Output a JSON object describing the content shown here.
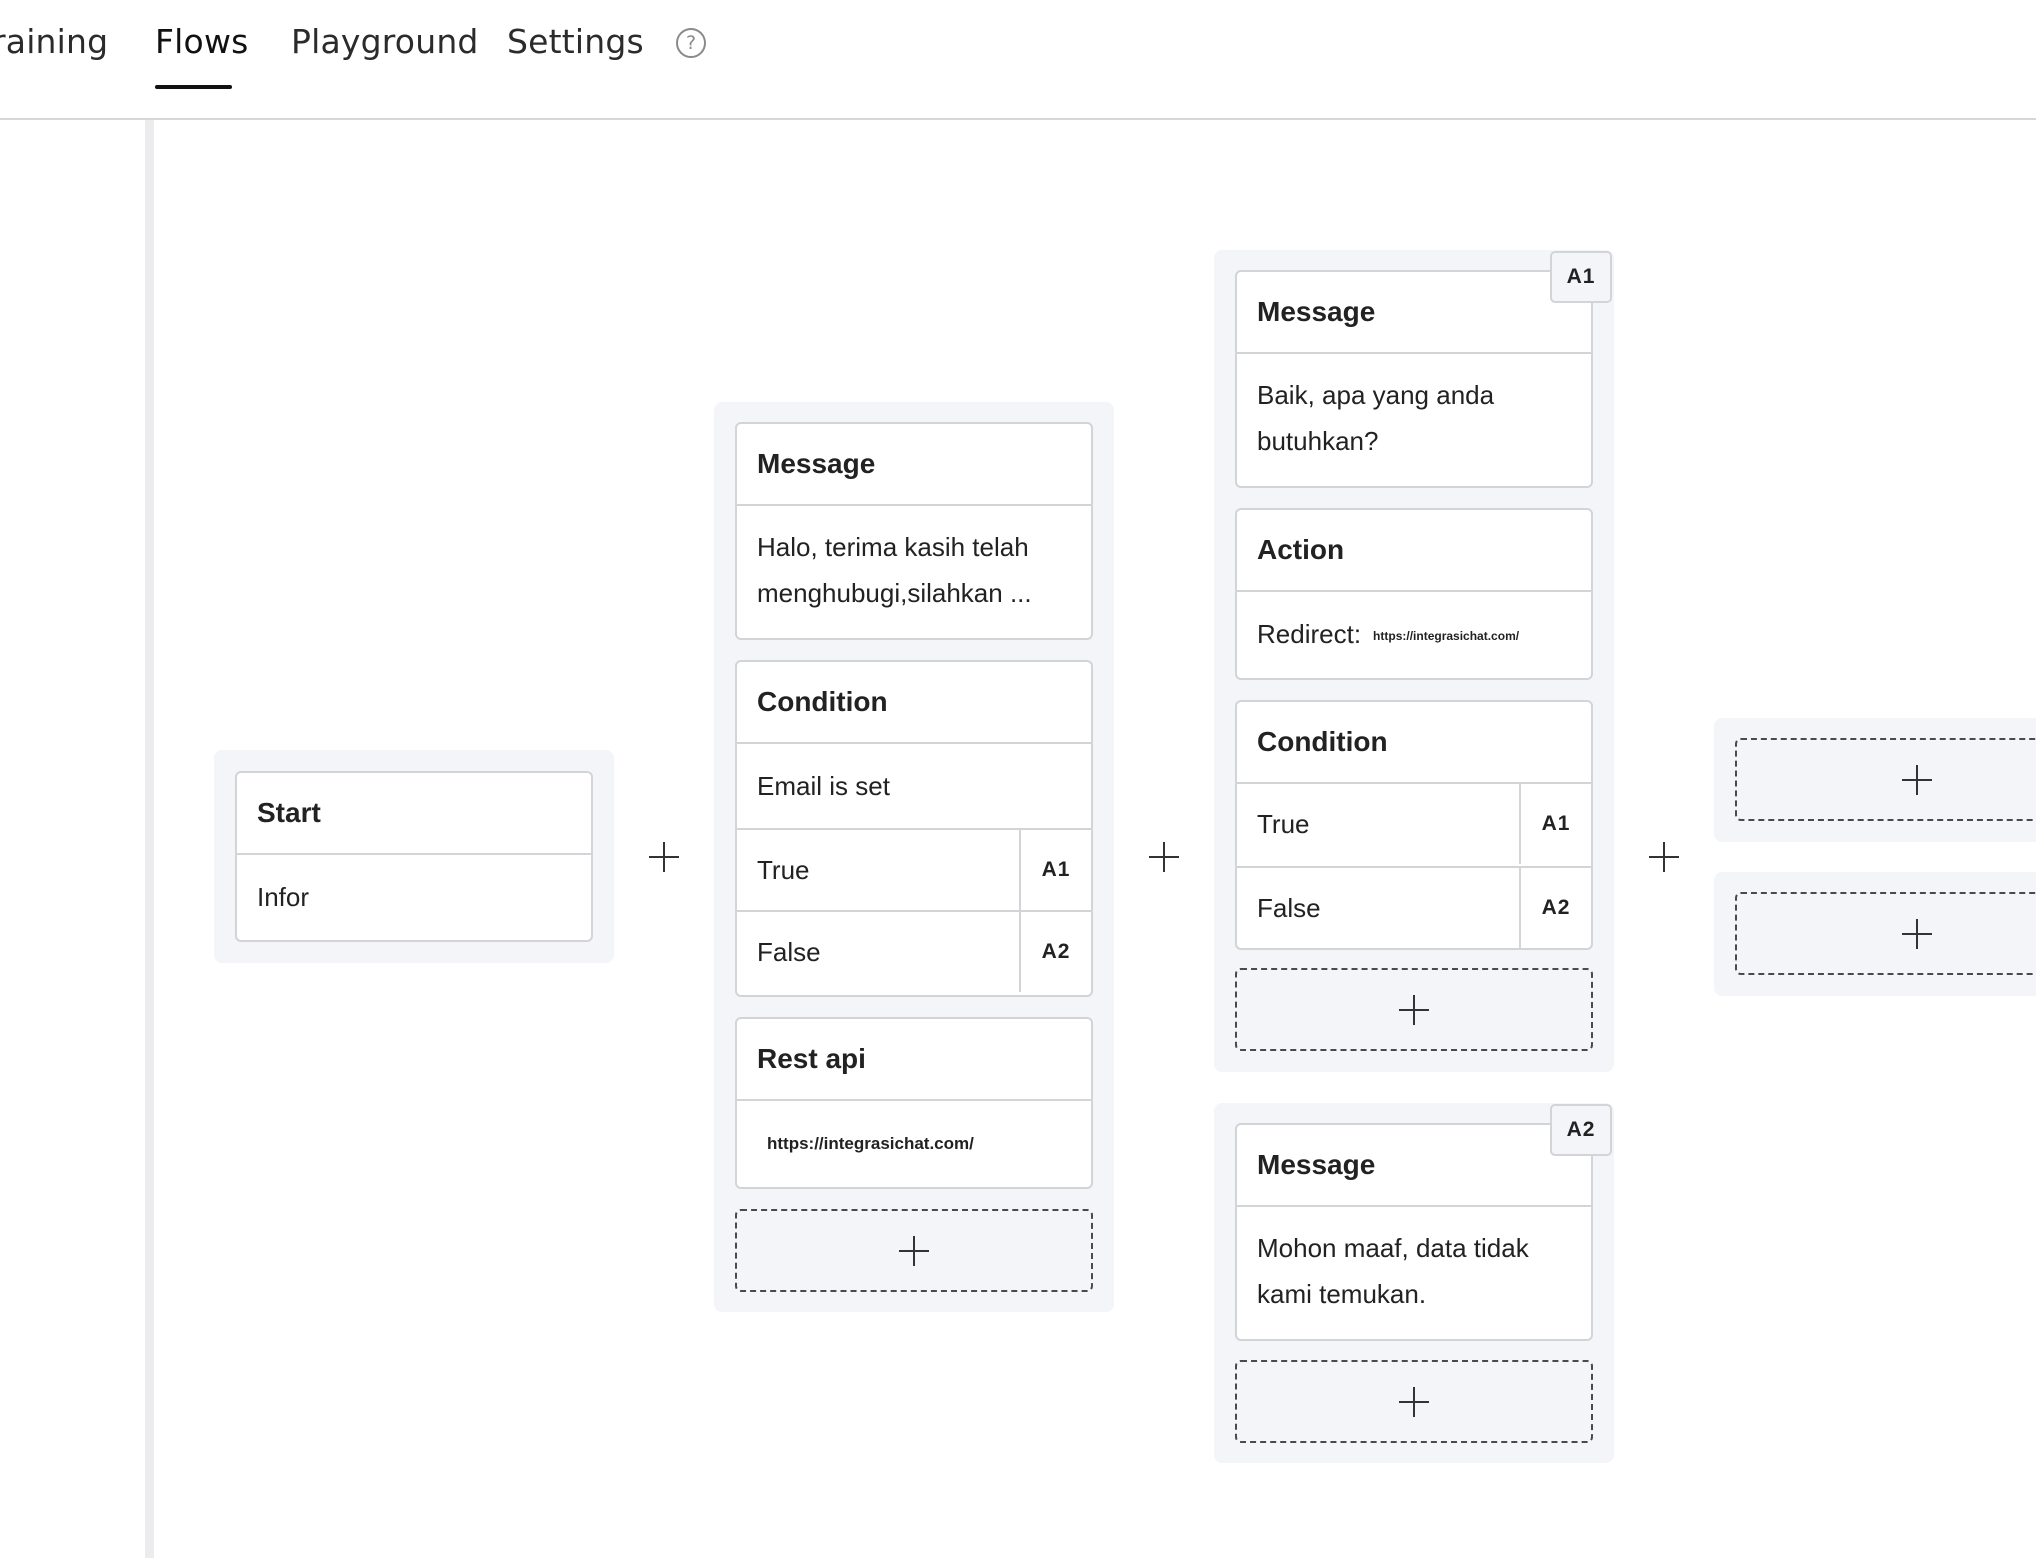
{
  "nav": {
    "tabs": [
      {
        "label": "raining"
      },
      {
        "label": "Flows"
      },
      {
        "label": "Playground"
      },
      {
        "label": "Settings"
      }
    ],
    "active_tab": "Flows",
    "help_glyph": "?"
  },
  "flow": {
    "start": {
      "title": "Start",
      "body": "Infor"
    },
    "column2": {
      "message": {
        "title": "Message",
        "body": "Halo, terima kasih telah menghubugi,silahkan ..."
      },
      "condition": {
        "title": "Condition",
        "expr": "Email is set",
        "branches": [
          {
            "label": "True",
            "target": "A1"
          },
          {
            "label": "False",
            "target": "A2"
          }
        ]
      },
      "rest_api": {
        "title": "Rest api",
        "url": "https://integrasichat.com/"
      }
    },
    "a1": {
      "badge": "A1",
      "message": {
        "title": "Message",
        "body": "Baik, apa yang anda butuhkan?"
      },
      "action": {
        "title": "Action",
        "label": "Redirect:",
        "url": "https://integrasichat.com/"
      },
      "condition": {
        "title": "Condition",
        "branches": [
          {
            "label": "True",
            "target": "A1"
          },
          {
            "label": "False",
            "target": "A2"
          }
        ]
      }
    },
    "a2": {
      "badge": "A2",
      "message": {
        "title": "Message",
        "body": "Mohon maaf, data tidak kami temukan."
      }
    }
  },
  "colors": {
    "group_bg": "#f4f5f8",
    "border": "#d3d4d8",
    "active_underline": "#111111"
  }
}
